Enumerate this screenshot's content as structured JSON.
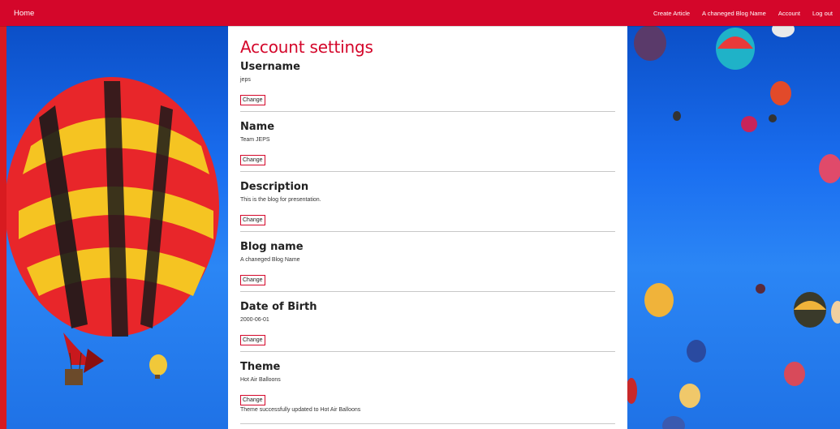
{
  "nav": {
    "home": "Home",
    "links": [
      "Create Article",
      "A chaneged Blog Name",
      "Account",
      "Log out"
    ]
  },
  "page_title": "Account settings",
  "sections": [
    {
      "title": "Username",
      "value": "jeps",
      "button": "Change"
    },
    {
      "title": "Name",
      "value": "Team JEPS",
      "button": "Change"
    },
    {
      "title": "Description",
      "value": "This is the blog for presentation.",
      "button": "Change"
    },
    {
      "title": "Blog name",
      "value": "A chaneged Blog Name",
      "button": "Change"
    },
    {
      "title": "Date of Birth",
      "value": "2000-06-01",
      "button": "Change"
    },
    {
      "title": "Theme",
      "value": "Hot Air Balloons",
      "button": "Change"
    }
  ],
  "theme_message": "Theme successfully updated to Hot Air Balloons",
  "colors": {
    "accent": "#d4062a",
    "sky": "#1a6ef0"
  }
}
